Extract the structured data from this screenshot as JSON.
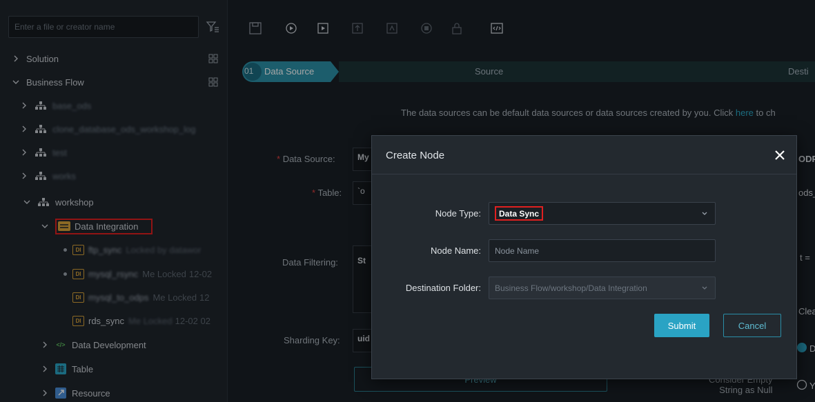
{
  "sidebar": {
    "search_placeholder": "Enter a file or creator name",
    "items": [
      {
        "label": "Solution"
      },
      {
        "label": "Business Flow"
      },
      {
        "label": "base_ods"
      },
      {
        "label": "clone_database_ods_workshop_log"
      },
      {
        "label": "test"
      },
      {
        "label": "works"
      },
      {
        "label": "workshop"
      },
      {
        "label": "Data Integration"
      },
      {
        "label": "ftp_sync",
        "status": "Locked by datawor"
      },
      {
        "label": "mysql_rsync",
        "status": "Me Locked",
        "time": "12-02"
      },
      {
        "label": "mysql_to_odps",
        "status": "Me Locked",
        "time": "12"
      },
      {
        "label": "rds_sync",
        "status": "Me Locked",
        "time": "12-02 02"
      },
      {
        "label": "Data Development"
      },
      {
        "label": "Table"
      },
      {
        "label": "Resource"
      }
    ],
    "badge": "DI"
  },
  "main": {
    "steps": {
      "num": "01",
      "active": "Data Source",
      "second": "Source",
      "third": "Desti"
    },
    "info_prefix": "The data sources can be default data sources or data sources created by you. Click ",
    "info_link": "here",
    "info_suffix": " to ch",
    "form": {
      "data_source_label": "Data Source:",
      "data_source_value": "My",
      "table_label": "Table:",
      "table_value": "`o",
      "filter_label": "Data Filtering:",
      "filter_value": "St",
      "sharding_label": "Sharding Key:",
      "sharding_value": "uid",
      "preview_button": "Preview",
      "required_mark": "*"
    },
    "right_fragments": {
      "odps": "ODP",
      "ods": "ods_",
      "eq": "t =",
      "clear": "Clea",
      "d": "D",
      "y": "Y",
      "consider_line1": "Consider Empty",
      "consider_line2": "String as Null"
    }
  },
  "modal": {
    "title": "Create Node",
    "node_type_label": "Node Type:",
    "node_type_value": "Data Sync",
    "node_name_label": "Node Name:",
    "node_name_placeholder": "Node Name",
    "folder_label": "Destination Folder:",
    "folder_value": "Business Flow/workshop/Data Integration",
    "submit": "Submit",
    "cancel": "Cancel"
  },
  "colors": {
    "accent": "#2aa3c4",
    "highlight": "#e02020",
    "badge": "#d8a23a"
  }
}
